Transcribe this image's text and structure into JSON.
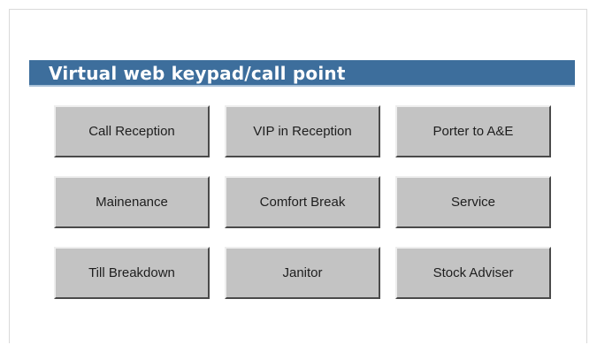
{
  "title": "Virtual web keypad/call point",
  "keys": [
    "Call Reception",
    "VIP in Reception",
    "Porter to A&E",
    "Mainenance",
    "Comfort Break",
    "Service",
    "Till Breakdown",
    "Janitor",
    "Stock Adviser"
  ],
  "colors": {
    "title_bar": "#3d6e9c",
    "button_face": "#c3c3c3"
  }
}
